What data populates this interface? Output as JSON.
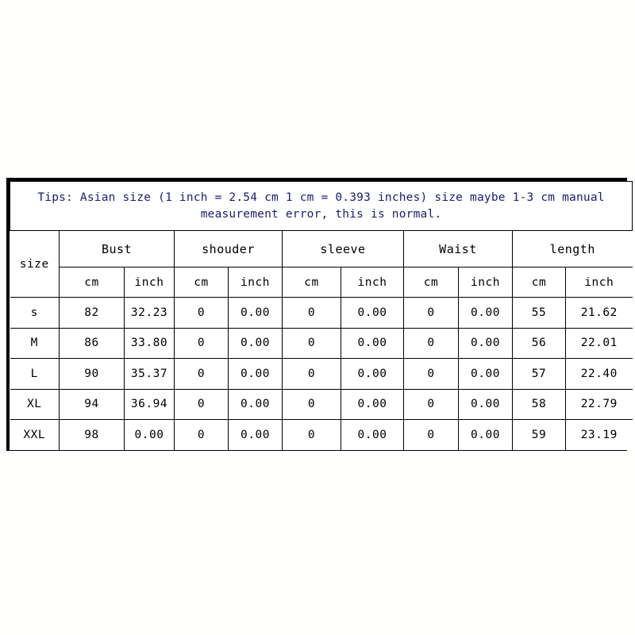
{
  "tips": {
    "line_1": "Tips: Asian size (1 inch = 2.54 cm 1 cm = 0.393 inches) size maybe 1-3 cm manual",
    "line_2": "measurement error, this is normal.",
    "color": "#1b1b6e"
  },
  "table": {
    "size_header": "size",
    "groups": [
      {
        "label": "Bust"
      },
      {
        "label": "shouder"
      },
      {
        "label": "sleeve"
      },
      {
        "label": "Waist"
      },
      {
        "label": "length"
      }
    ],
    "units": [
      "cm",
      "inch",
      "cm",
      "inch",
      "cm",
      "inch",
      "cm",
      "inch",
      "cm",
      "inch"
    ],
    "rows": [
      {
        "size": "s",
        "bust_cm": "82",
        "bust_inch": "32.23",
        "shoulder_cm": "0",
        "shoulder_inch": "0.00",
        "sleeve_cm": "0",
        "sleeve_inch": "0.00",
        "waist_cm": "0",
        "waist_inch": "0.00",
        "length_cm": "55",
        "length_inch": "21.62"
      },
      {
        "size": "M",
        "bust_cm": "86",
        "bust_inch": "33.80",
        "shoulder_cm": "0",
        "shoulder_inch": "0.00",
        "sleeve_cm": "0",
        "sleeve_inch": "0.00",
        "waist_cm": "0",
        "waist_inch": "0.00",
        "length_cm": "56",
        "length_inch": "22.01"
      },
      {
        "size": "L",
        "bust_cm": "90",
        "bust_inch": "35.37",
        "shoulder_cm": "0",
        "shoulder_inch": "0.00",
        "sleeve_cm": "0",
        "sleeve_inch": "0.00",
        "waist_cm": "0",
        "waist_inch": "0.00",
        "length_cm": "57",
        "length_inch": "22.40"
      },
      {
        "size": "XL",
        "bust_cm": "94",
        "bust_inch": "36.94",
        "shoulder_cm": "0",
        "shoulder_inch": "0.00",
        "sleeve_cm": "0",
        "sleeve_inch": "0.00",
        "waist_cm": "0",
        "waist_inch": "0.00",
        "length_cm": "58",
        "length_inch": "22.79"
      },
      {
        "size": "XXL",
        "bust_cm": "98",
        "bust_inch": "0.00",
        "shoulder_cm": "0",
        "shoulder_inch": "0.00",
        "sleeve_cm": "0",
        "sleeve_inch": "0.00",
        "waist_cm": "0",
        "waist_inch": "0.00",
        "length_cm": "59",
        "length_inch": "23.19"
      }
    ]
  },
  "chart_data": {
    "type": "table",
    "title": "Asian size chart",
    "columns": [
      "size",
      "Bust cm",
      "Bust inch",
      "shouder cm",
      "shouder inch",
      "sleeve cm",
      "sleeve inch",
      "Waist cm",
      "Waist inch",
      "length cm",
      "length inch"
    ],
    "values": [
      [
        "s",
        "82",
        "32.23",
        "0",
        "0.00",
        "0",
        "0.00",
        "0",
        "0.00",
        "55",
        "21.62"
      ],
      [
        "M",
        "86",
        "33.80",
        "0",
        "0.00",
        "0",
        "0.00",
        "0",
        "0.00",
        "56",
        "22.01"
      ],
      [
        "L",
        "90",
        "35.37",
        "0",
        "0.00",
        "0",
        "0.00",
        "0",
        "0.00",
        "57",
        "22.40"
      ],
      [
        "XL",
        "94",
        "36.94",
        "0",
        "0.00",
        "0",
        "0.00",
        "0",
        "0.00",
        "58",
        "22.79"
      ],
      [
        "XXL",
        "98",
        "0.00",
        "0",
        "0.00",
        "0",
        "0.00",
        "0",
        "0.00",
        "59",
        "23.19"
      ]
    ]
  }
}
